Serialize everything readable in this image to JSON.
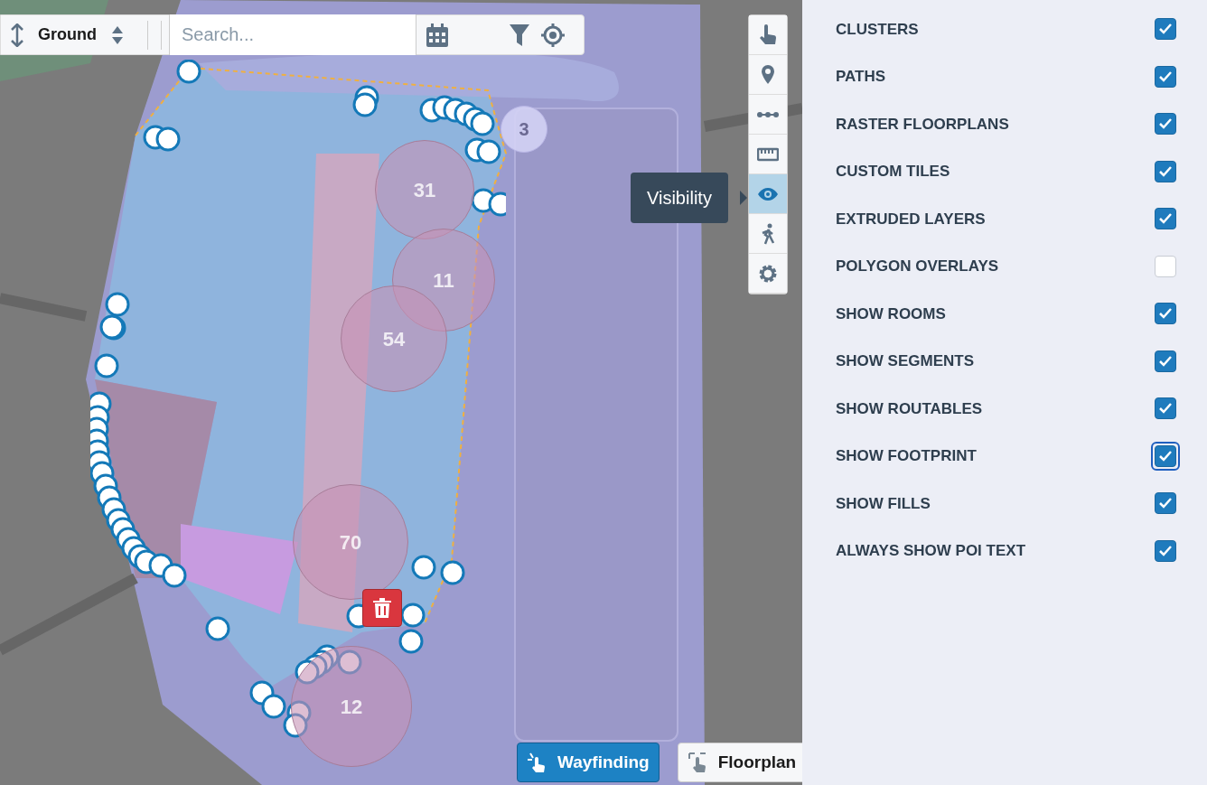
{
  "floor_selector": {
    "label": "Ground"
  },
  "search": {
    "placeholder": "Search..."
  },
  "tools": [
    {
      "kind": "pointer",
      "selected": false
    },
    {
      "kind": "pin",
      "selected": false
    },
    {
      "kind": "path",
      "selected": false
    },
    {
      "kind": "ruler",
      "selected": false
    },
    {
      "kind": "visibility",
      "selected": true
    },
    {
      "kind": "walk",
      "selected": false
    },
    {
      "kind": "settings",
      "selected": false
    }
  ],
  "tooltip": {
    "text": "Visibility"
  },
  "clusters": [
    {
      "count": "3",
      "kind": "light"
    },
    {
      "count": "31",
      "kind": "pink"
    },
    {
      "count": "11",
      "kind": "pink"
    },
    {
      "count": "54",
      "kind": "pink"
    },
    {
      "count": "70",
      "kind": "pink"
    },
    {
      "count": "12",
      "kind": "pink"
    }
  ],
  "modes": [
    {
      "label": "Wayfinding",
      "selected": true
    },
    {
      "label": "Floorplan",
      "selected": false
    }
  ],
  "layers": [
    {
      "label": "CLUSTERS",
      "checked": true,
      "focused": false
    },
    {
      "label": "PATHS",
      "checked": true,
      "focused": false
    },
    {
      "label": "RASTER FLOORPLANS",
      "checked": true,
      "focused": false
    },
    {
      "label": "CUSTOM TILES",
      "checked": true,
      "focused": false
    },
    {
      "label": "EXTRUDED LAYERS",
      "checked": true,
      "focused": false
    },
    {
      "label": "POLYGON OVERLAYS",
      "checked": false,
      "focused": false
    },
    {
      "label": "SHOW ROOMS",
      "checked": true,
      "focused": false
    },
    {
      "label": "SHOW SEGMENTS",
      "checked": true,
      "focused": false
    },
    {
      "label": "SHOW ROUTABLES",
      "checked": true,
      "focused": false
    },
    {
      "label": "SHOW FOOTPRINT",
      "checked": true,
      "focused": true
    },
    {
      "label": "SHOW FILLS",
      "checked": true,
      "focused": false
    },
    {
      "label": "ALWAYS SHOW POI TEXT",
      "checked": true,
      "focused": false
    }
  ]
}
